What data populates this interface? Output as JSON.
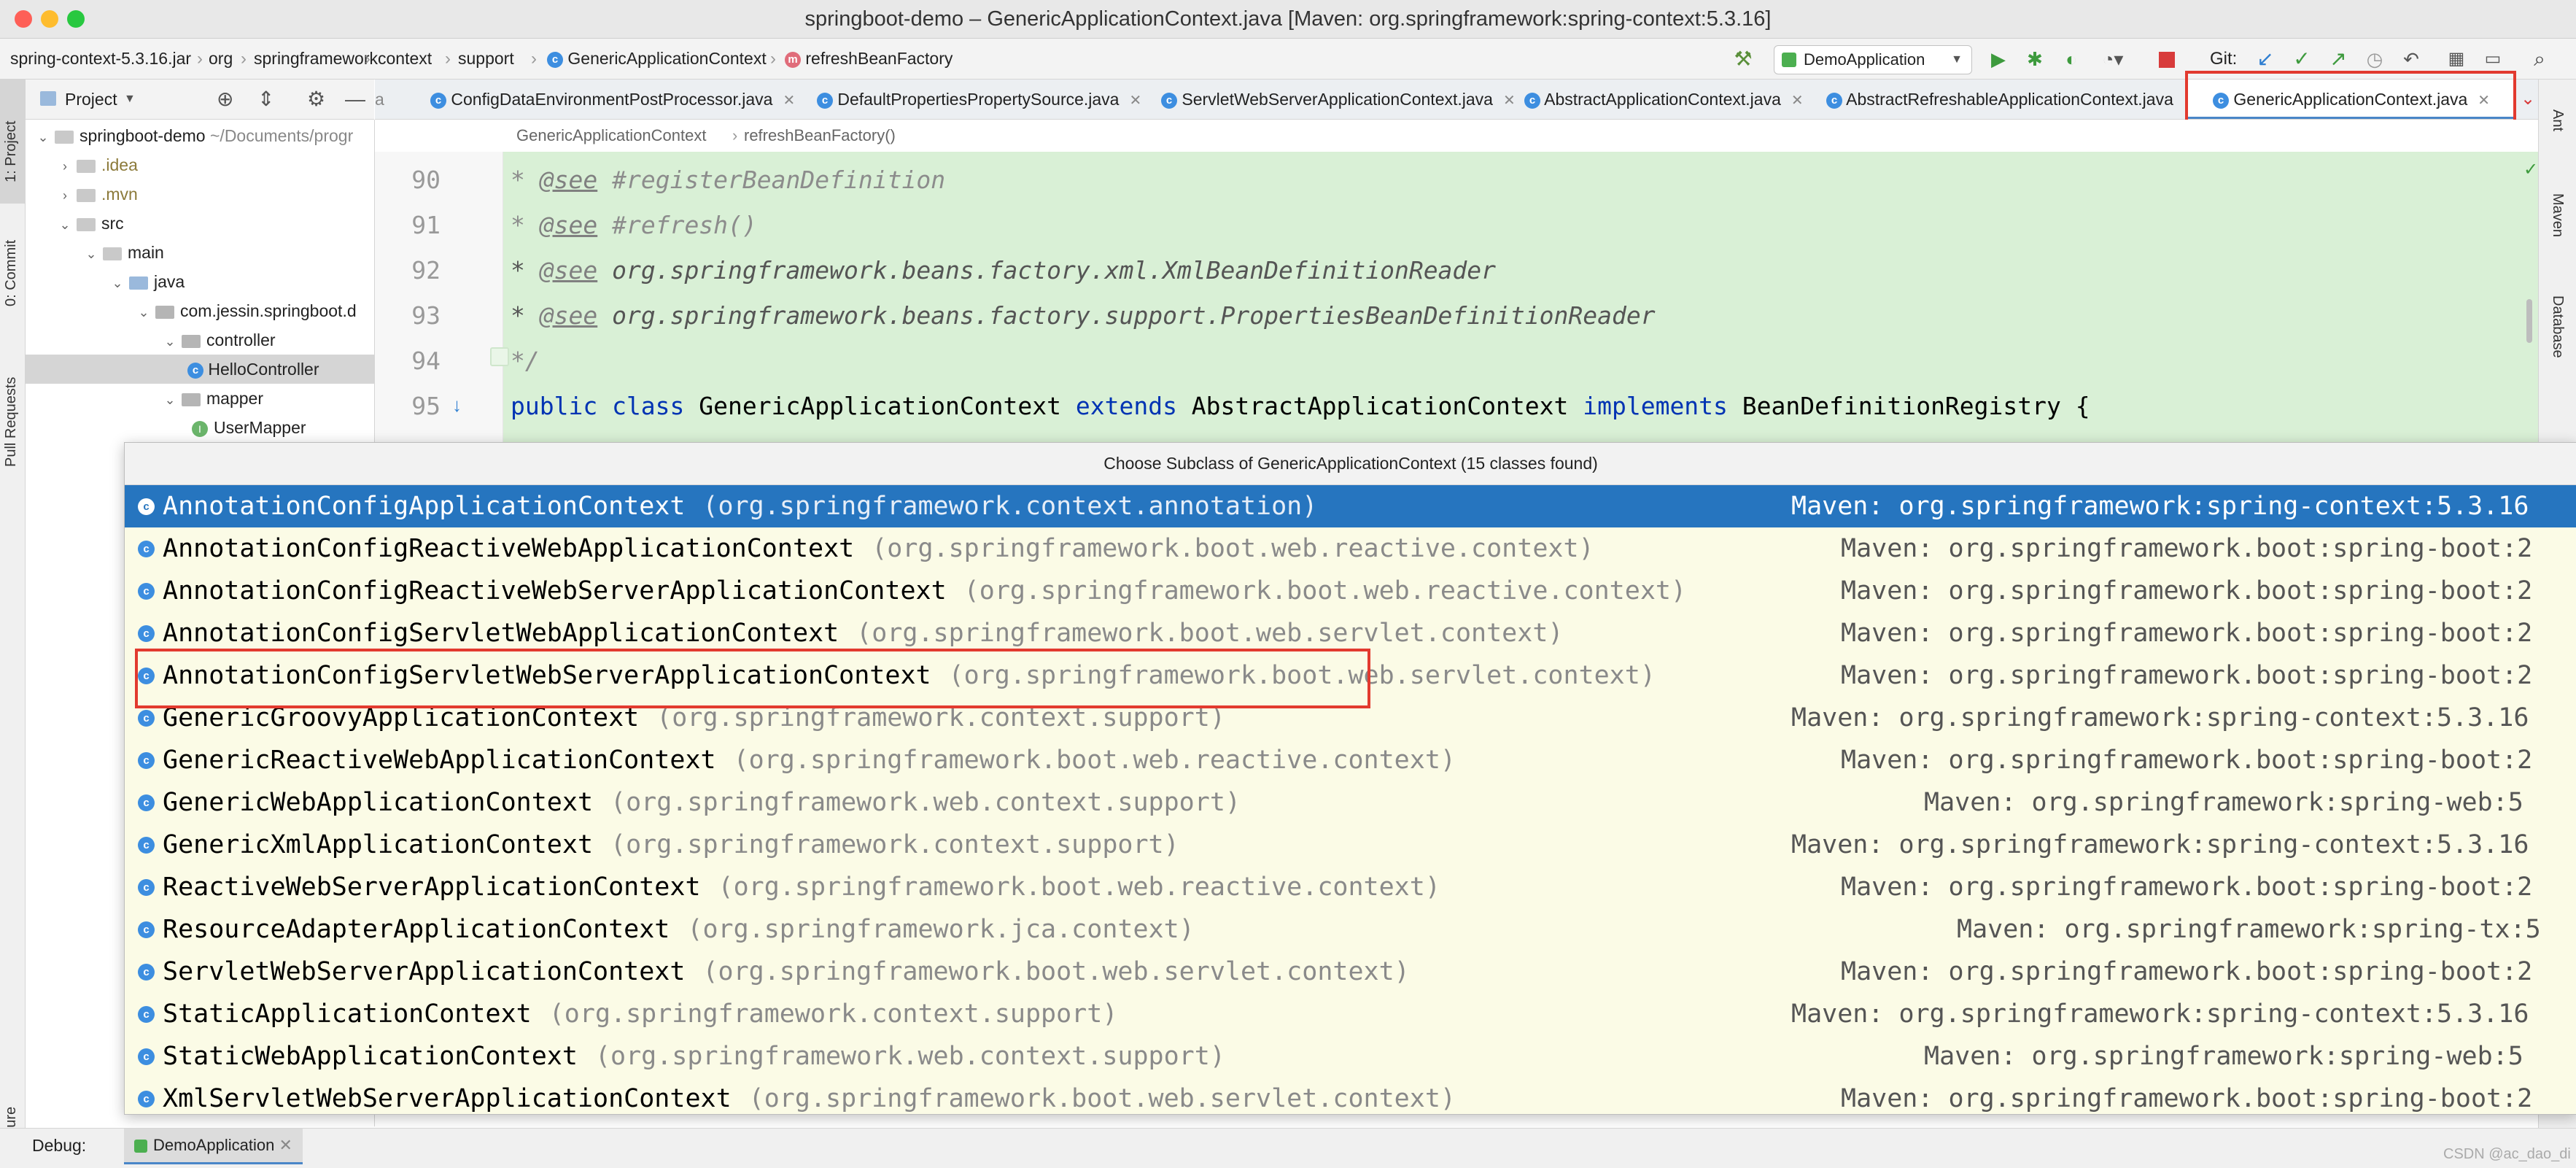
{
  "window": {
    "title": "springboot-demo – GenericApplicationContext.java [Maven: org.springframework:spring-context:5.3.16]",
    "traffic_colors": [
      "#fe5f57",
      "#febc2e",
      "#28c840"
    ]
  },
  "breadcrumbs": [
    "spring-context-5.3.16.jar",
    "org",
    "springframework",
    "context",
    "support",
    "GenericApplicationContext",
    "refreshBeanFactory"
  ],
  "toolbar": {
    "run_config": "DemoApplication",
    "git_label": "Git:"
  },
  "left_stripe": {
    "project": "1: Project",
    "commit": "0: Commit",
    "pull_requests": "Pull Requests",
    "structure": "Structure"
  },
  "right_stripe": {
    "ant": "Ant",
    "maven": "Maven",
    "database": "Database"
  },
  "project_panel": {
    "header": "Project",
    "tree": [
      {
        "label": "springboot-demo",
        "suffix": "~/Documents/progr"
      },
      {
        "label": ".idea"
      },
      {
        "label": ".mvn"
      },
      {
        "label": "src"
      },
      {
        "label": "main"
      },
      {
        "label": "java"
      },
      {
        "label": "com.jessin.springboot.d"
      },
      {
        "label": "controller"
      },
      {
        "label": "HelloController"
      },
      {
        "label": "mapper"
      },
      {
        "label": "UserMapper"
      }
    ]
  },
  "tabs": [
    {
      "label": "a"
    },
    {
      "label": "ConfigDataEnvironmentPostProcessor.java"
    },
    {
      "label": "DefaultPropertiesPropertySource.java"
    },
    {
      "label": "ServletWebServerApplicationContext.java"
    },
    {
      "label": "AbstractApplicationContext.java"
    },
    {
      "label": "AbstractRefreshableApplicationContext.java"
    },
    {
      "label": "GenericApplicationContext.java"
    }
  ],
  "editor": {
    "breadcrumb": [
      "GenericApplicationContext",
      "refreshBeanFactory()"
    ],
    "lines": [
      {
        "num": "90",
        "tag": "@see",
        "text": " #registerBeanDefinition"
      },
      {
        "num": "91",
        "tag": "@see",
        "text": " #refresh()"
      },
      {
        "num": "92",
        "tag": "@see",
        "text": " org.springframework.beans.factory.xml.XmlBeanDefinitionReader"
      },
      {
        "num": "93",
        "tag": "@see",
        "text": " org.springframework.beans.factory.support.PropertiesBeanDefinitionReader"
      },
      {
        "num": "94",
        "text": "*/"
      },
      {
        "num": "95"
      }
    ],
    "decl": {
      "kw1": "public class",
      "name": " GenericApplicationContext ",
      "kw2": "extends",
      "parent": " AbstractApplicationContext ",
      "kw3": "implements",
      "iface": " BeanDefinitionRegistry {"
    }
  },
  "popup": {
    "title": "Choose Subclass of GenericApplicationContext (15 classes found)",
    "items": [
      {
        "name": "AnnotationConfigApplicationContext",
        "pkg": "(org.springframework.context.annotation)",
        "lib": "Maven: org.springframework:spring-context:5.3.16"
      },
      {
        "name": "AnnotationConfigReactiveWebApplicationContext",
        "pkg": "(org.springframework.boot.web.reactive.context)",
        "lib": "Maven: org.springframework.boot:spring-boot:2"
      },
      {
        "name": "AnnotationConfigReactiveWebServerApplicationContext",
        "pkg": "(org.springframework.boot.web.reactive.context)",
        "lib": "Maven: org.springframework.boot:spring-boot:2"
      },
      {
        "name": "AnnotationConfigServletWebApplicationContext",
        "pkg": "(org.springframework.boot.web.servlet.context)",
        "lib": "Maven: org.springframework.boot:spring-boot:2"
      },
      {
        "name": "AnnotationConfigServletWebServerApplicationContext",
        "pkg": "(org.springframework.boot.web.servlet.context)",
        "lib": "Maven: org.springframework.boot:spring-boot:2"
      },
      {
        "name": "GenericGroovyApplicationContext",
        "pkg": "(org.springframework.context.support)",
        "lib": "Maven: org.springframework:spring-context:5.3.16"
      },
      {
        "name": "GenericReactiveWebApplicationContext",
        "pkg": "(org.springframework.boot.web.reactive.context)",
        "lib": "Maven: org.springframework.boot:spring-boot:2"
      },
      {
        "name": "GenericWebApplicationContext",
        "pkg": "(org.springframework.web.context.support)",
        "lib": "Maven: org.springframework:spring-web:5"
      },
      {
        "name": "GenericXmlApplicationContext",
        "pkg": "(org.springframework.context.support)",
        "lib": "Maven: org.springframework:spring-context:5.3.16"
      },
      {
        "name": "ReactiveWebServerApplicationContext",
        "pkg": "(org.springframework.boot.web.reactive.context)",
        "lib": "Maven: org.springframework.boot:spring-boot:2"
      },
      {
        "name": "ResourceAdapterApplicationContext",
        "pkg": "(org.springframework.jca.context)",
        "lib": "Maven: org.springframework:spring-tx:5"
      },
      {
        "name": "ServletWebServerApplicationContext",
        "pkg": "(org.springframework.boot.web.servlet.context)",
        "lib": "Maven: org.springframework.boot:spring-boot:2"
      },
      {
        "name": "StaticApplicationContext",
        "pkg": "(org.springframework.context.support)",
        "lib": "Maven: org.springframework:spring-context:5.3.16"
      },
      {
        "name": "StaticWebApplicationContext",
        "pkg": "(org.springframework.web.context.support)",
        "lib": "Maven: org.springframework:spring-web:5"
      },
      {
        "name": "XmlServletWebServerApplicationContext",
        "pkg": "(org.springframework.boot.web.servlet.context)",
        "lib": "Maven: org.springframework.boot:spring-boot:2"
      }
    ]
  },
  "debug": {
    "label": "Debug:",
    "tab": "DemoApplication"
  },
  "watermark": "CSDN @ac_dao_di",
  "colors": {
    "selection": "#2675bf",
    "highlight_box": "#e23a2f",
    "editor_bg": "#d9f0d6",
    "popup_bg": "#fbfbe6"
  }
}
